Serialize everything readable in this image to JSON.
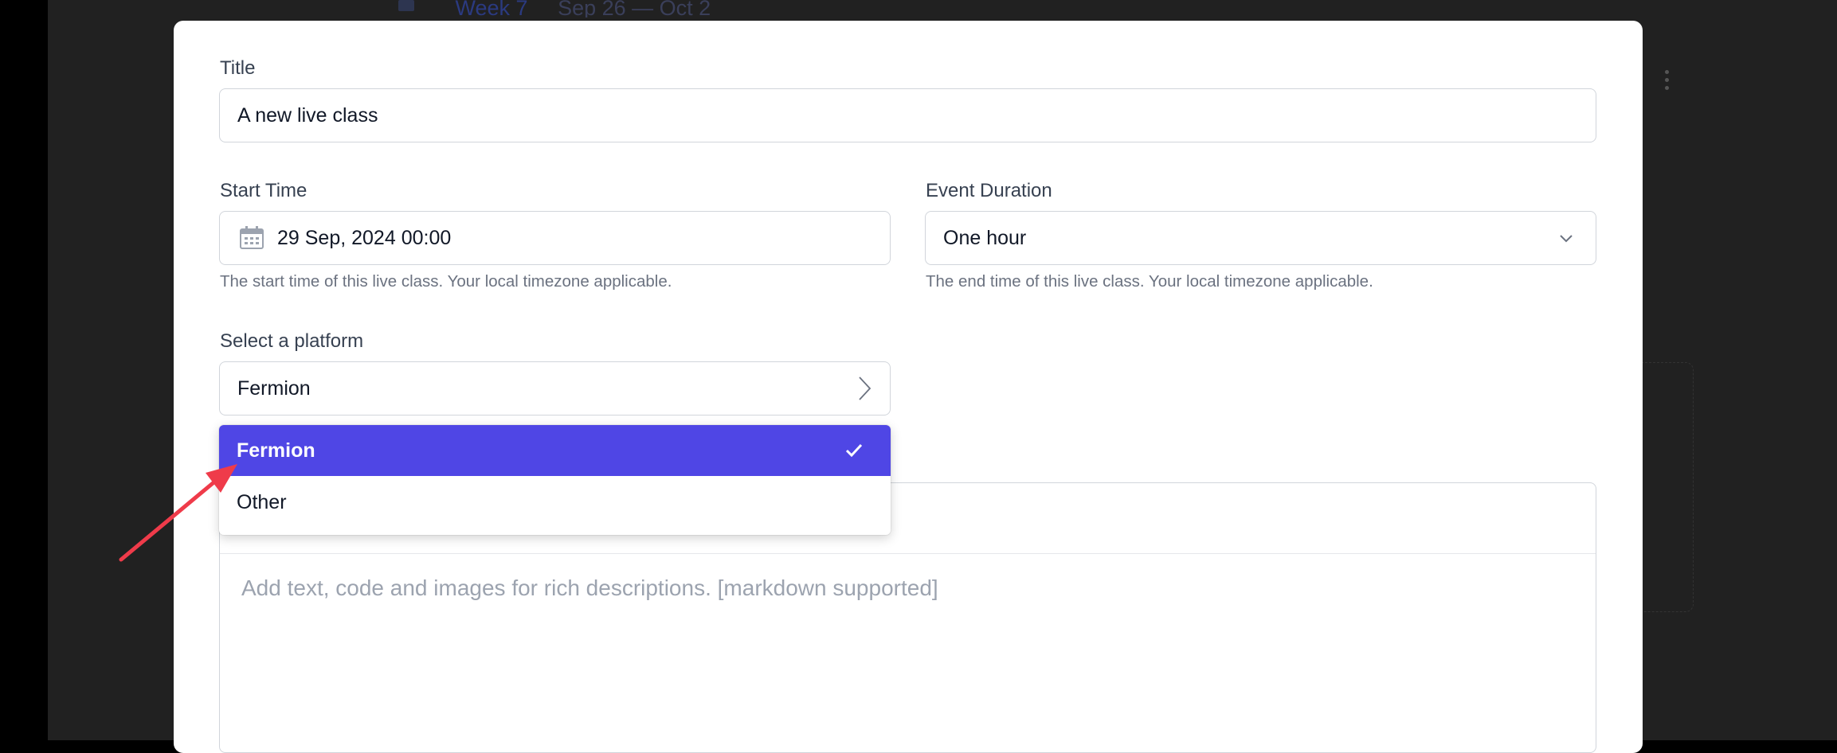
{
  "background": {
    "week_label": "Week 7",
    "week_range": "Sep 26 — Oct 2"
  },
  "form": {
    "title": {
      "label": "Title",
      "value": "A new live class"
    },
    "start_time": {
      "label": "Start Time",
      "value": "29 Sep, 2024 00:00",
      "help": "The start time of this live class. Your local timezone applicable."
    },
    "event_duration": {
      "label": "Event Duration",
      "value": "One hour",
      "help": "The end time of this live class. Your local timezone applicable."
    },
    "platform": {
      "label": "Select a platform",
      "value": "Fermion",
      "options": [
        "Fermion",
        "Other"
      ]
    },
    "description": {
      "placeholder": "Add text, code and images for rich descriptions. [markdown supported]"
    }
  },
  "colors": {
    "accent": "#4f46e5",
    "annotation_arrow": "#ef3b4a"
  },
  "icons": {
    "calendar": "calendar-icon",
    "duration_dropdown": "chevron-down-icon",
    "platform_dropdown": "chevron-right-icon",
    "selected": "check-icon"
  }
}
